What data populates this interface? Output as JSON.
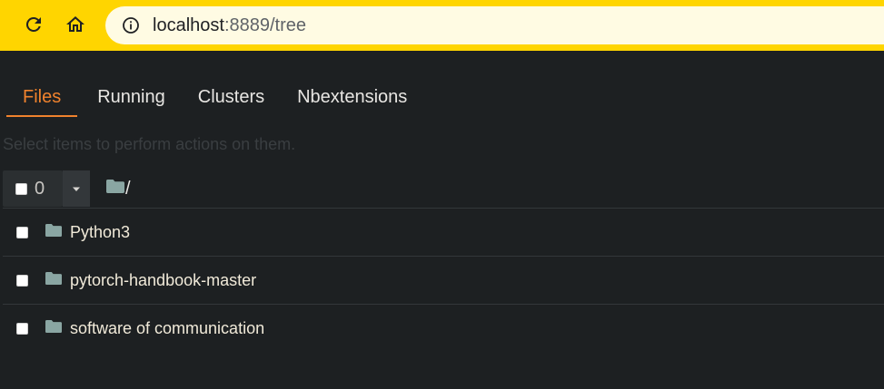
{
  "browser": {
    "url_host": "localhost",
    "url_rest": ":8889/tree"
  },
  "tabs": [
    {
      "label": "Files",
      "active": true
    },
    {
      "label": "Running",
      "active": false
    },
    {
      "label": "Clusters",
      "active": false
    },
    {
      "label": "Nbextensions",
      "active": false
    }
  ],
  "hint": "Select items to perform actions on them.",
  "toolbar": {
    "selected_count": "0",
    "breadcrumb_root": "/"
  },
  "files": [
    {
      "name": "Python3",
      "type": "folder"
    },
    {
      "name": "pytorch-handbook-master",
      "type": "folder"
    },
    {
      "name": "software of communication",
      "type": "folder"
    }
  ],
  "colors": {
    "chrome": "#ffd500",
    "accent": "#f0822d",
    "background": "#1d2022",
    "folder": "#8aa6a3"
  },
  "icons": [
    "reload-icon",
    "home-icon",
    "info-icon",
    "caret-down-icon",
    "folder-icon"
  ]
}
